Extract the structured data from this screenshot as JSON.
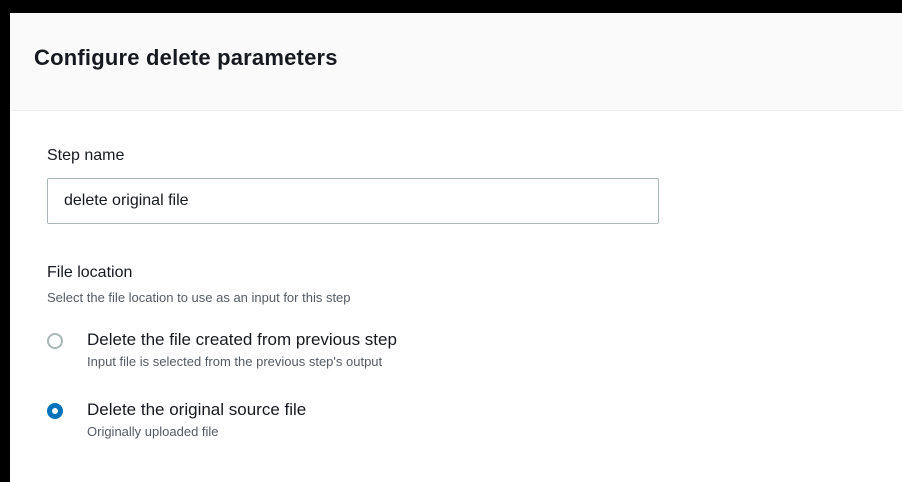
{
  "panel": {
    "title": "Configure delete parameters"
  },
  "step_name": {
    "label": "Step name",
    "value": "delete original file"
  },
  "file_location": {
    "label": "File location",
    "description": "Select the file location to use as an input for this step",
    "options": [
      {
        "title": "Delete the file created from previous step",
        "description": "Input file is selected from the previous step's output",
        "selected": false
      },
      {
        "title": "Delete the original source file",
        "description": "Originally uploaded file",
        "selected": true
      }
    ]
  },
  "colors": {
    "accent": "#0073bb",
    "border": "#aab7b8",
    "header_bg": "#fafafa",
    "text": "#16191f",
    "secondary_text": "#545b64"
  }
}
